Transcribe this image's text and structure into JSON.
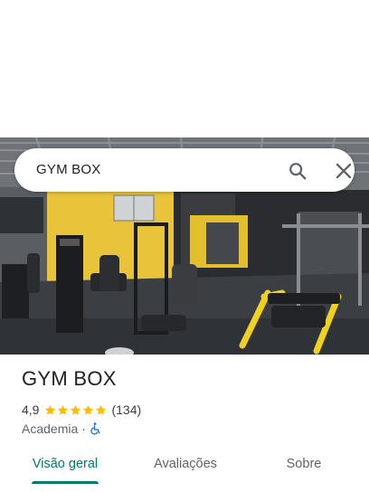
{
  "search": {
    "query": "GYM BOX"
  },
  "place": {
    "name": "GYM BOX",
    "rating": "4,9",
    "rating_value": 4.9,
    "stars_filled": 5,
    "review_count": "(134)",
    "category": "Academia",
    "separator": "·",
    "accessibility_icon": "wheelchair-icon"
  },
  "tabs": [
    {
      "label": "Visão geral",
      "active": true
    },
    {
      "label": "Avaliações",
      "active": false
    },
    {
      "label": "Sobre",
      "active": false
    }
  ],
  "colors": {
    "accent": "#00796b",
    "star": "#fbbc04",
    "accessibility": "#1a73e8",
    "wall_yellow": "#e9c33a",
    "machine_yellow": "#f1d21a"
  }
}
